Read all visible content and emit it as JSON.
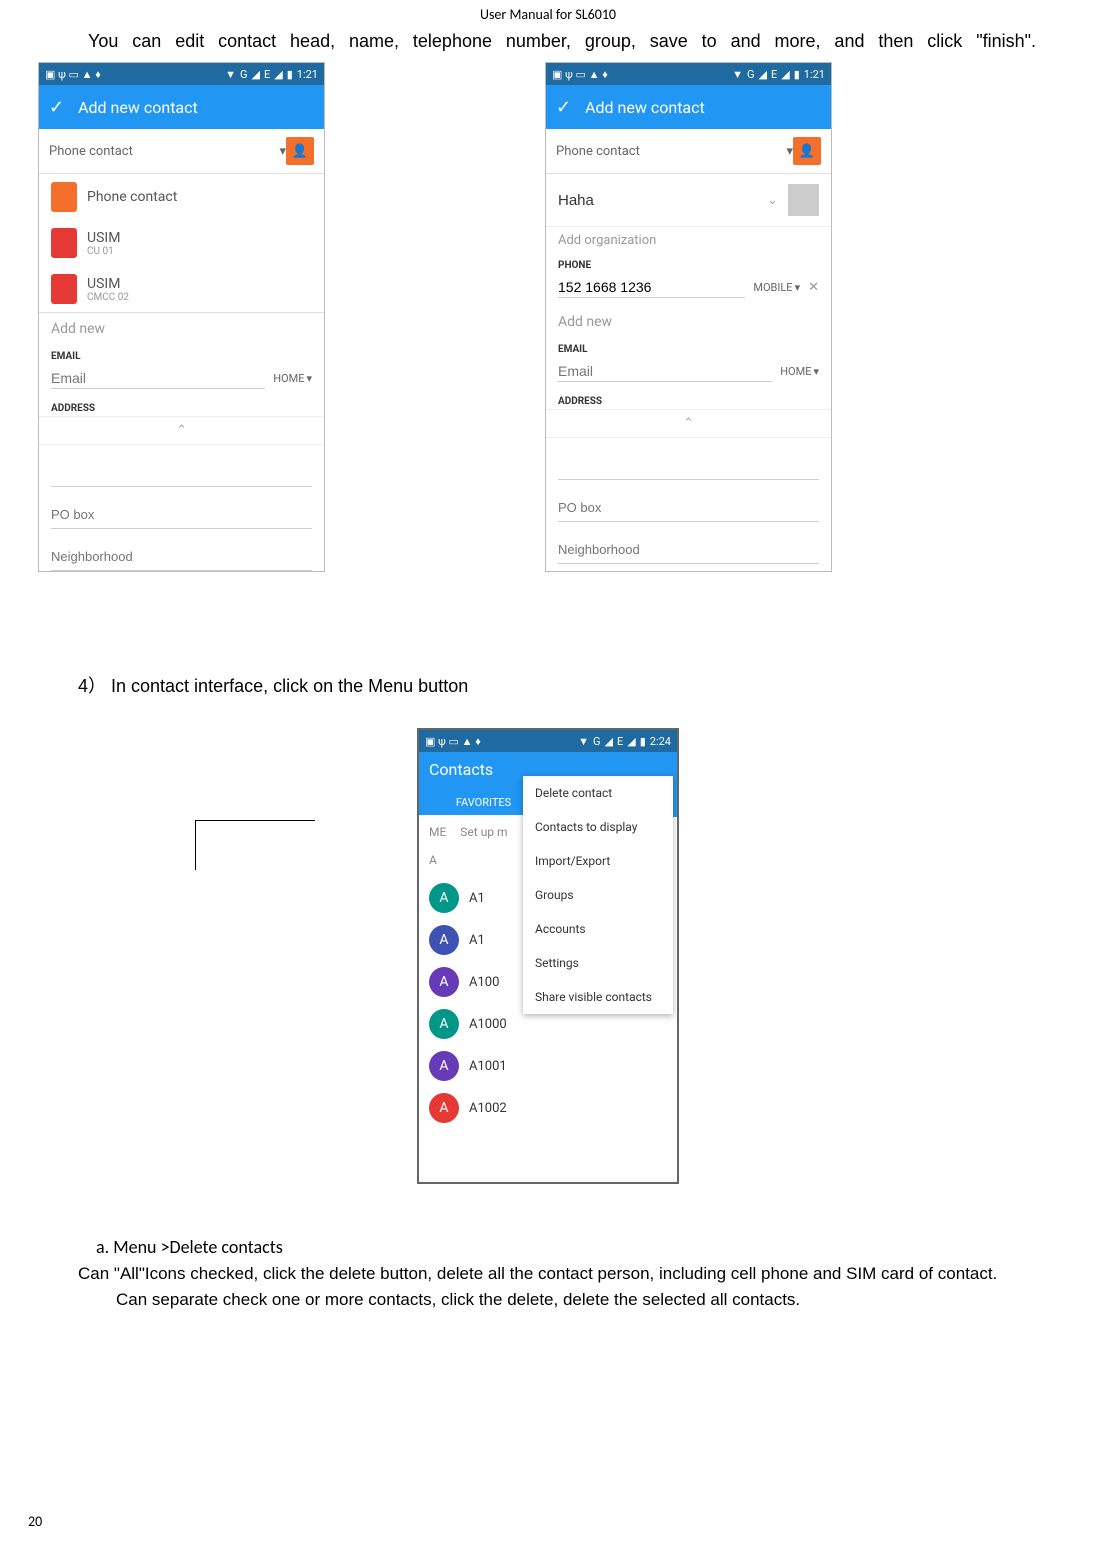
{
  "doc_header": "User Manual for SL6010",
  "intro": "You can edit contact head, name, telephone number, group, save to and more, and then click \"finish\".",
  "status": {
    "time": "1:21",
    "net": "G",
    "sig": "E",
    "wifi": "▼"
  },
  "screen1": {
    "title": "Add new contact",
    "account": "Phone contact",
    "dd": [
      {
        "t1": "Phone contact",
        "t2": ""
      },
      {
        "t1": "USIM",
        "t2": "CU 01"
      },
      {
        "t1": "USIM",
        "t2": "CMCC 02"
      }
    ],
    "add_new": "Add new",
    "email_label": "EMAIL",
    "email_ph": "Email",
    "email_type": "HOME",
    "addr_label": "ADDRESS",
    "po": "PO box",
    "nb": "Neighborhood"
  },
  "screen2": {
    "title": "Add new contact",
    "account": "Phone contact",
    "name": "Haha",
    "org_ph": "Add organization",
    "phone_label": "PHONE",
    "phone_val": "152 1668 1236",
    "phone_type": "MOBILE",
    "add_new": "Add new",
    "email_label": "EMAIL",
    "email_ph": "Email",
    "email_type": "HOME",
    "addr_label": "ADDRESS",
    "po": "PO box",
    "nb": "Neighborhood"
  },
  "step4": "4） In contact   interface, click on the Menu button",
  "screen3": {
    "status_time": "2:24",
    "title": "Contacts",
    "tab_fav": "FAVORITES",
    "me": "ME",
    "me_txt": "Set up m",
    "sec": "A",
    "menu": [
      "Delete contact",
      "Contacts to display",
      "Import/Export",
      "Groups",
      "Accounts",
      "Settings",
      "Share visible contacts"
    ],
    "contacts": [
      {
        "av": "A",
        "nm": "A1",
        "c": "c-green"
      },
      {
        "av": "A",
        "nm": "A1",
        "c": "c-blue"
      },
      {
        "av": "A",
        "nm": "A100",
        "c": "c-purple"
      },
      {
        "av": "A",
        "nm": "A1000",
        "c": "c-teal"
      },
      {
        "av": "A",
        "nm": "A1001",
        "c": "c-purple"
      },
      {
        "av": "A",
        "nm": "A1002",
        "c": "c-red"
      }
    ]
  },
  "sub": {
    "hd": "a.   Menu >Delete contacts",
    "p1": "Can \"All\"Icons checked, click the delete button, delete all the contact person, including cell phone and SIM card of contact.",
    "p2": "Can separate check one or more contacts, click the delete, delete the selected all contacts."
  },
  "page_num": "20"
}
